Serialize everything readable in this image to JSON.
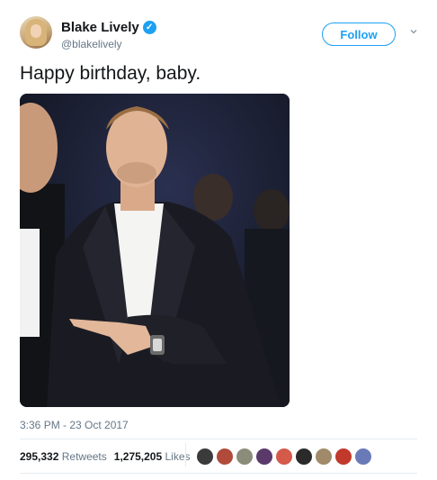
{
  "user": {
    "display_name": "Blake Lively",
    "handle": "@blakelively",
    "verified_icon": "verified-badge-icon"
  },
  "follow_label": "Follow",
  "tweet": {
    "text": "Happy birthday, baby.",
    "timestamp": "3:36 PM - 23 Oct 2017"
  },
  "stats": {
    "retweets_count": "295,332",
    "retweets_label": "Retweets",
    "likes_count": "1,275,205",
    "likes_label": "Likes"
  },
  "likers": [
    {
      "color": "#3b3b3b"
    },
    {
      "color": "#b04a3a"
    },
    {
      "color": "#8c8c7a"
    },
    {
      "color": "#5a3a6a"
    },
    {
      "color": "#d45a4a"
    },
    {
      "color": "#2a2a2a"
    },
    {
      "color": "#a08a6a"
    },
    {
      "color": "#c0392b"
    },
    {
      "color": "#6a7ab8"
    }
  ],
  "colors": {
    "accent": "#1da1f2",
    "text": "#14171a",
    "secondary": "#657786"
  }
}
